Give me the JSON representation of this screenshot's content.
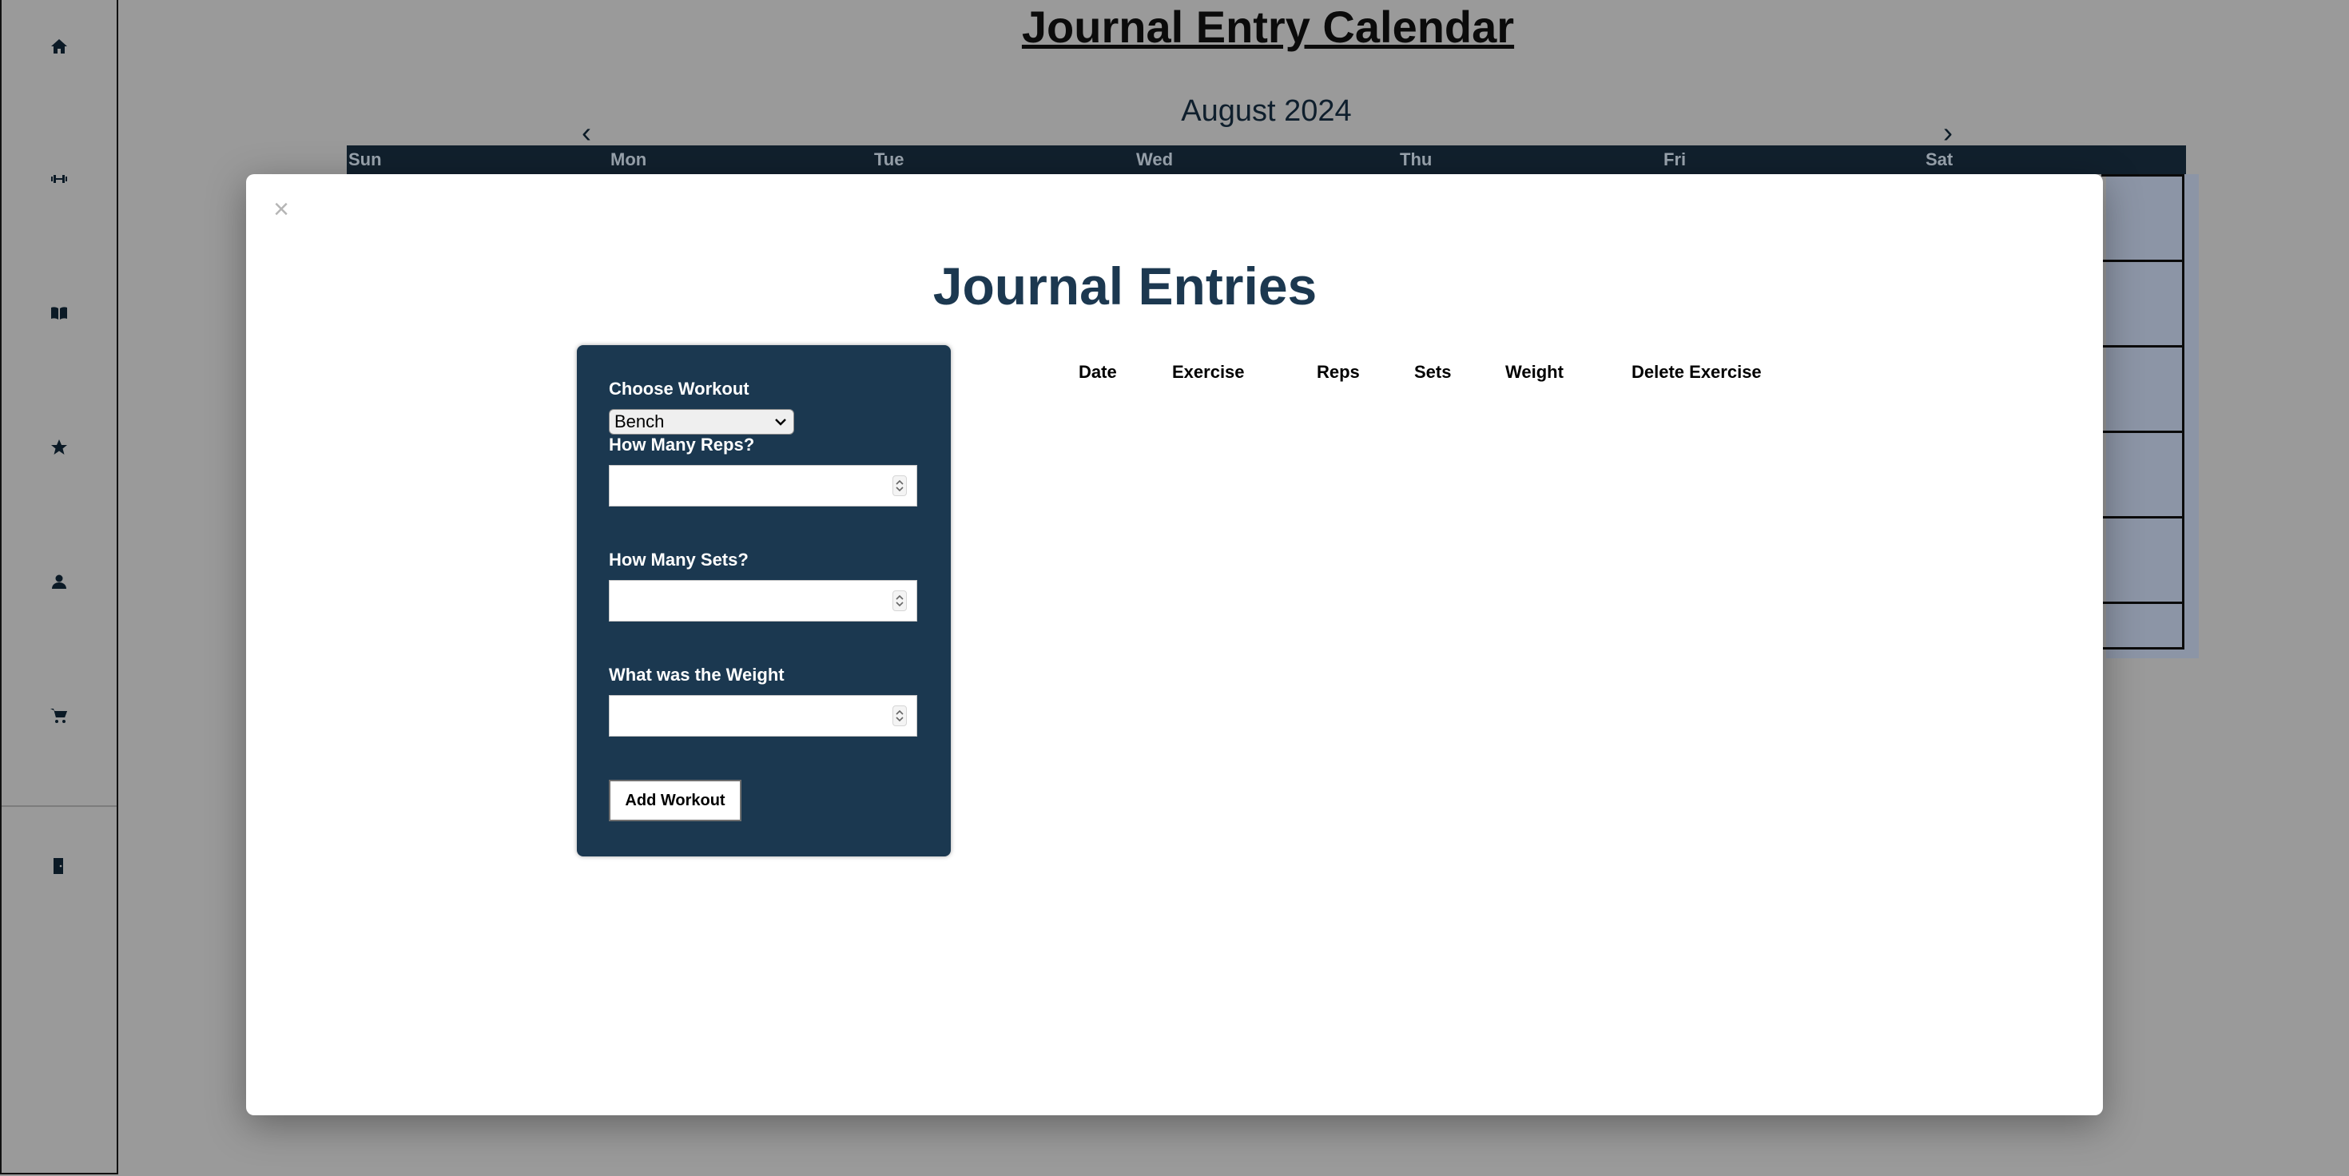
{
  "sidebar": {
    "items": [
      {
        "icon": "home-icon"
      },
      {
        "icon": "dumbbell-icon"
      },
      {
        "icon": "book-icon"
      },
      {
        "icon": "star-icon"
      },
      {
        "icon": "user-icon"
      },
      {
        "icon": "cart-icon"
      },
      {
        "icon": "logout-door-icon"
      }
    ]
  },
  "calendar": {
    "title": "Journal Entry Calendar",
    "month_label": "August 2024",
    "prev_arrow": "‹",
    "next_arrow": "›",
    "weekdays": [
      "Sun",
      "Mon",
      "Tue",
      "Wed",
      "Thu",
      "Fri",
      "Sat"
    ]
  },
  "modal": {
    "close_symbol": "×",
    "title": "Journal Entries",
    "form": {
      "choose_workout_label": "Choose Workout",
      "workout_selected": "Bench",
      "reps_label": "How Many Reps?",
      "reps_value": "",
      "sets_label": "How Many Sets?",
      "sets_value": "",
      "weight_label": "What was the Weight",
      "weight_value": "",
      "add_button": "Add Workout"
    },
    "table": {
      "headers": [
        "Date",
        "Exercise",
        "Reps",
        "Sets",
        "Weight",
        "Delete Exercise"
      ]
    }
  },
  "colors": {
    "overlay": "#9a9a9a",
    "form_panel": "#1b3850",
    "title_text": "#1c3850",
    "weekday_bar": "#11202d"
  }
}
